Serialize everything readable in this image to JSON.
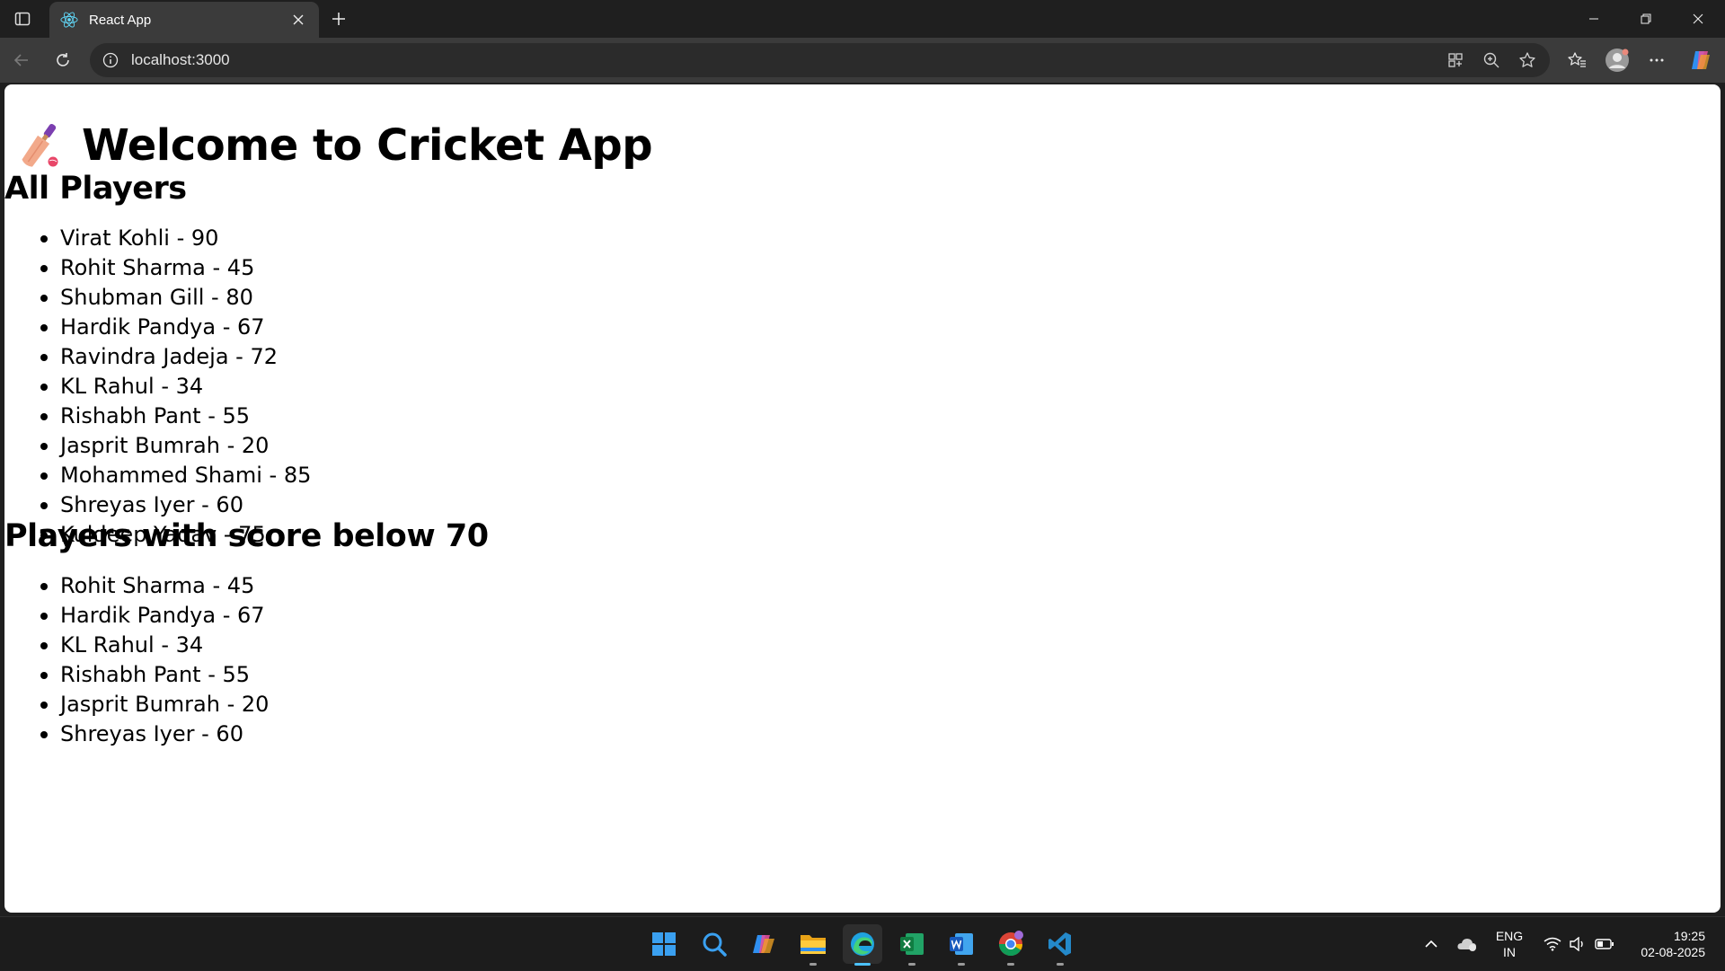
{
  "browser": {
    "tab_title": "React App",
    "url": "localhost:3000"
  },
  "page": {
    "title": "Welcome to Cricket App",
    "all_players_heading": "All Players",
    "all_players": [
      "Virat Kohli - 90",
      "Rohit Sharma - 45",
      "Shubman Gill - 80",
      "Hardik Pandya - 67",
      "Ravindra Jadeja - 72",
      "KL Rahul - 34",
      "Rishabh Pant - 55",
      "Jasprit Bumrah - 20",
      "Mohammed Shami - 85",
      "Shreyas Iyer - 60",
      "Kuldeep Yadav - 75"
    ],
    "below_70_heading": "Players with score below 70",
    "below_70_players": [
      "Rohit Sharma - 45",
      "Hardik Pandya - 67",
      "KL Rahul - 34",
      "Rishabh Pant - 55",
      "Jasprit Bumrah - 20",
      "Shreyas Iyer - 60"
    ]
  },
  "taskbar": {
    "language_line1": "ENG",
    "language_line2": "IN",
    "time": "19:25",
    "date": "02-08-2025",
    "apps": [
      "start-icon",
      "search-icon",
      "copilot-icon",
      "file-explorer-icon",
      "edge-icon",
      "excel-icon",
      "word-icon",
      "chrome-icon",
      "vscode-icon"
    ]
  },
  "colors": {
    "chrome_dark": "#1f1f1f",
    "toolbar": "#3b3b3b",
    "accent": "#4cc2ff"
  }
}
